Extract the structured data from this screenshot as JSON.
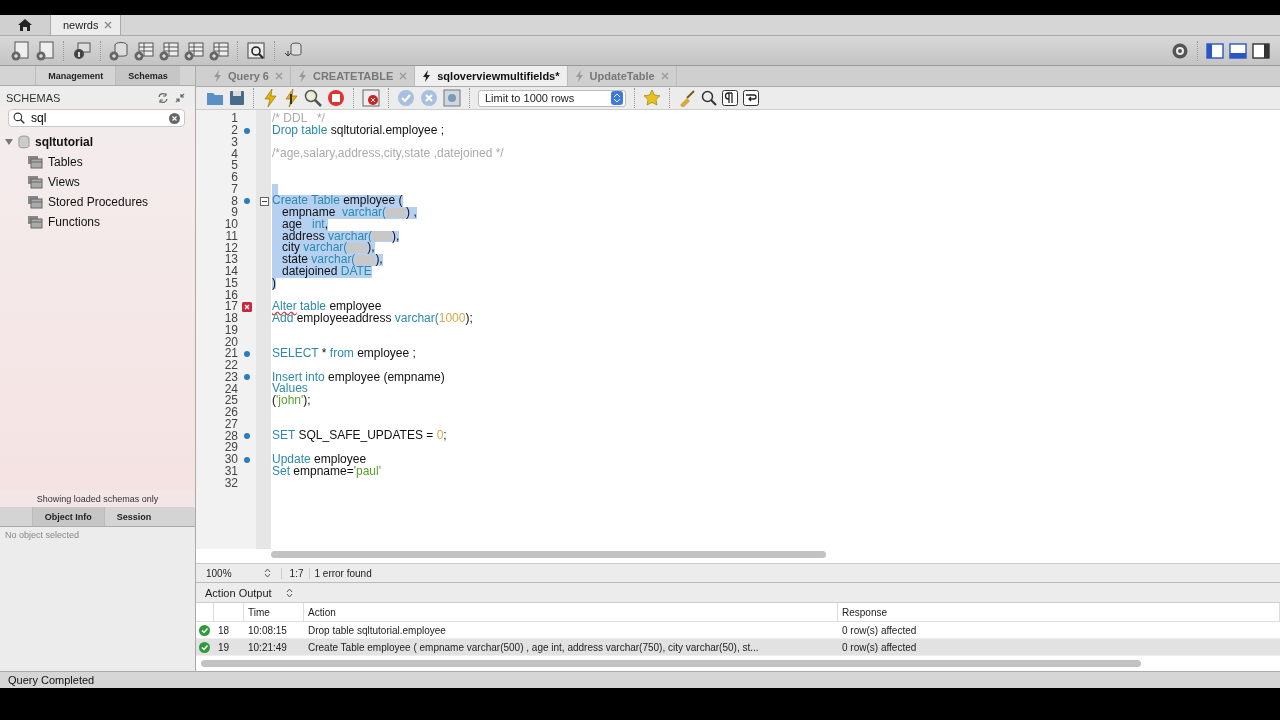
{
  "connection_tabs": [
    {
      "label": "newrds",
      "selected": true
    }
  ],
  "sidebar": {
    "tabs": [
      {
        "label": "Management",
        "selected": false
      },
      {
        "label": "Schemas",
        "selected": true
      }
    ],
    "title": "SCHEMAS",
    "search": {
      "value": "sql"
    },
    "tree": [
      {
        "label": "sqltutorial",
        "expanded": true,
        "children": [
          {
            "label": "Tables"
          },
          {
            "label": "Views"
          },
          {
            "label": "Stored Procedures"
          },
          {
            "label": "Functions"
          }
        ]
      }
    ],
    "footer": "Showing loaded schemas only",
    "info_tabs": [
      {
        "label": "Object Info",
        "selected": true
      },
      {
        "label": "Session",
        "selected": false
      }
    ],
    "info_text": "No object selected"
  },
  "query_tabs": [
    {
      "label": "Query 6",
      "selected": false
    },
    {
      "label": "CREATETABLE",
      "selected": false
    },
    {
      "label": "sqloverviewmultifields*",
      "selected": true
    },
    {
      "label": "UpdateTable",
      "selected": false
    }
  ],
  "limit_select": {
    "value": "Limit to 1000 rows"
  },
  "editor": {
    "lines": [
      {
        "number": "1",
        "tokens": [
          {
            "kind": "comment",
            "text": "/* DDL   */"
          }
        ]
      },
      {
        "number": "2",
        "statement": true,
        "tokens": [
          {
            "kind": "keyword",
            "text": "Drop table"
          },
          {
            "kind": "ident",
            "text": " sqltutorial.employee ;"
          }
        ]
      },
      {
        "number": "3"
      },
      {
        "number": "4",
        "tokens": [
          {
            "kind": "comment",
            "text": "/*age,salary,address,city,state ,datejoined */"
          }
        ]
      },
      {
        "number": "5"
      },
      {
        "number": "6"
      },
      {
        "number": "7",
        "selected": true
      },
      {
        "number": "8",
        "selected": true,
        "statement": true,
        "fold": true,
        "tokens": [
          {
            "kind": "keyword",
            "text": "Create Table"
          },
          {
            "kind": "ident",
            "text": " employee ("
          }
        ]
      },
      {
        "number": "9",
        "selected": true,
        "tokens": [
          {
            "kind": "ident",
            "text": "   empname  "
          },
          {
            "kind": "keyword",
            "text": "varchar("
          },
          {
            "kind": "masked"
          },
          {
            "kind": "ident",
            "text": ") ,"
          }
        ]
      },
      {
        "number": "10",
        "selected": true,
        "tokens": [
          {
            "kind": "ident",
            "text": "   age   "
          },
          {
            "kind": "keyword",
            "text": "int"
          },
          {
            "kind": "ident",
            "text": ","
          }
        ]
      },
      {
        "number": "11",
        "selected": true,
        "tokens": [
          {
            "kind": "ident",
            "text": "   address "
          },
          {
            "kind": "keyword",
            "text": "varchar("
          },
          {
            "kind": "masked"
          },
          {
            "kind": "ident",
            "text": "),"
          }
        ]
      },
      {
        "number": "12",
        "selected": true,
        "tokens": [
          {
            "kind": "ident",
            "text": "   city "
          },
          {
            "kind": "keyword",
            "text": "varchar("
          },
          {
            "kind": "masked"
          },
          {
            "kind": "ident",
            "text": "),"
          }
        ]
      },
      {
        "number": "13",
        "selected": true,
        "tokens": [
          {
            "kind": "ident",
            "text": "   state "
          },
          {
            "kind": "keyword",
            "text": "varchar("
          },
          {
            "kind": "masked"
          },
          {
            "kind": "ident",
            "text": "),"
          }
        ]
      },
      {
        "number": "14",
        "selected": true,
        "tokens": [
          {
            "kind": "ident",
            "text": "   datejoined "
          },
          {
            "kind": "keyword",
            "text": "DATE"
          }
        ]
      },
      {
        "number": "15",
        "selected": true,
        "tokens": [
          {
            "kind": "ident",
            "text": ")"
          }
        ]
      },
      {
        "number": "16"
      },
      {
        "number": "17",
        "error": true,
        "tokens": [
          {
            "kind": "error",
            "text": "Alter"
          },
          {
            "kind": "keyword",
            "text": " table"
          },
          {
            "kind": "ident",
            "text": " employee"
          }
        ]
      },
      {
        "number": "18",
        "tokens": [
          {
            "kind": "keyword",
            "text": "Add"
          },
          {
            "kind": "ident",
            "text": " employeeaddress "
          },
          {
            "kind": "keyword",
            "text": "varchar("
          },
          {
            "kind": "number",
            "text": "1000"
          },
          {
            "kind": "ident",
            "text": ");"
          }
        ]
      },
      {
        "number": "19"
      },
      {
        "number": "20"
      },
      {
        "number": "21",
        "statement": true,
        "tokens": [
          {
            "kind": "keyword",
            "text": "SELECT"
          },
          {
            "kind": "ident",
            "text": " * "
          },
          {
            "kind": "keyword",
            "text": "from"
          },
          {
            "kind": "ident",
            "text": " employee ;"
          }
        ]
      },
      {
        "number": "22"
      },
      {
        "number": "23",
        "statement": true,
        "tokens": [
          {
            "kind": "keyword",
            "text": "Insert into"
          },
          {
            "kind": "ident",
            "text": " employee (empname)"
          }
        ]
      },
      {
        "number": "24",
        "tokens": [
          {
            "kind": "keyword",
            "text": "Values"
          }
        ]
      },
      {
        "number": "25",
        "tokens": [
          {
            "kind": "ident",
            "text": "("
          },
          {
            "kind": "string",
            "text": "'john'"
          },
          {
            "kind": "ident",
            "text": ");"
          }
        ]
      },
      {
        "number": "26"
      },
      {
        "number": "27"
      },
      {
        "number": "28",
        "statement": true,
        "tokens": [
          {
            "kind": "keyword",
            "text": "SET"
          },
          {
            "kind": "ident",
            "text": " SQL_SAFE_UPDATES = "
          },
          {
            "kind": "number",
            "text": "0"
          },
          {
            "kind": "ident",
            "text": ";"
          }
        ]
      },
      {
        "number": "29"
      },
      {
        "number": "30",
        "statement": true,
        "tokens": [
          {
            "kind": "keyword",
            "text": "Update"
          },
          {
            "kind": "ident",
            "text": " employee"
          }
        ]
      },
      {
        "number": "31",
        "tokens": [
          {
            "kind": "keyword",
            "text": "Set"
          },
          {
            "kind": "ident",
            "text": " empname="
          },
          {
            "kind": "string",
            "text": "'paul'"
          }
        ]
      },
      {
        "number": "32"
      }
    ]
  },
  "editor_status": {
    "zoom": "100%",
    "position": "1:7",
    "message": "1 error found"
  },
  "output": {
    "selector": "Action Output",
    "columns": [
      "Time",
      "Action",
      "Response"
    ],
    "rows": [
      {
        "success": true,
        "number": "18",
        "time": "10:08:15",
        "action": "Drop table sqltutorial.employee",
        "response": "0 row(s) affected",
        "selected": false
      },
      {
        "success": true,
        "number": "19",
        "time": "10:21:49",
        "action": "Create Table employee (  empname  varchar(500) ,  age   int,     address varchar(750),     city varchar(50),  st...",
        "response": "0 row(s) affected",
        "selected": true
      }
    ]
  },
  "status_bar": "Query Completed"
}
